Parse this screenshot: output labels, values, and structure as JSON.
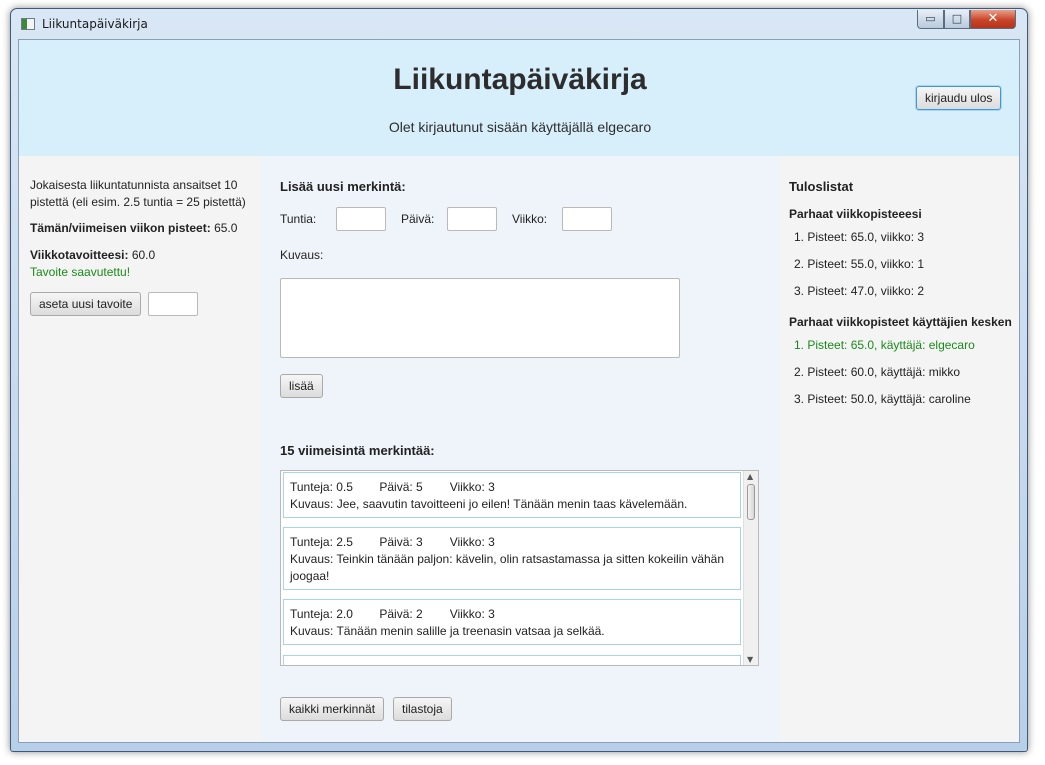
{
  "window": {
    "title": "Liikuntapäiväkirja",
    "controls": {
      "minimize": "▭",
      "maximize": "□",
      "close": "✕"
    }
  },
  "header": {
    "title": "Liikuntapäiväkirja",
    "subtitle": "Olet kirjautunut sisään käyttäjällä elgecaro",
    "logout_label": "kirjaudu ulos"
  },
  "left": {
    "info_line1": "Jokaisesta liikuntatunnista ansaitset 10",
    "info_line2": "pistettä (eli esim. 2.5 tuntia = 25 pistettä)",
    "week_points_label": "Tämän/viimeisen viikon pisteet:",
    "week_points_value": "65.0",
    "goal_label": "Viikkotavoitteesi:",
    "goal_value": "60.0",
    "goal_status": "Tavoite saavutettu!",
    "set_goal_label": "aseta uusi tavoite",
    "goal_input_value": ""
  },
  "form": {
    "heading": "Lisää uusi merkintä:",
    "hours_label": "Tuntia:",
    "day_label": "Päivä:",
    "week_label": "Viikko:",
    "description_label": "Kuvaus:",
    "add_label": "lisää"
  },
  "recent": {
    "heading": "15 viimeisintä merkintää:",
    "entries": [
      {
        "hours": "Tunteja: 0.5",
        "day": "Päivä: 5",
        "week": "Viikko: 3",
        "description": "Kuvaus: Jee, saavutin tavoitteeni jo eilen! Tänään menin taas kävelemään."
      },
      {
        "hours": "Tunteja: 2.5",
        "day": "Päivä: 3",
        "week": "Viikko: 3",
        "description": "Kuvaus: Teinkin tänään paljon: kävelin, olin ratsastamassa ja sitten kokeilin vähän joogaa!"
      },
      {
        "hours": "Tunteja: 2.0",
        "day": "Päivä: 2",
        "week": "Viikko: 3",
        "description": "Kuvaus: Tänään menin salille ja treenasin vatsaa ja selkää."
      }
    ],
    "all_entries_label": "kaikki merkinnät",
    "stats_label": "tilastoja"
  },
  "leaderboards": {
    "title": "Tuloslistat",
    "personal_heading": "Parhaat viikkopisteeesi",
    "personal": [
      "1. Pisteet: 65.0, viikko: 3",
      "2. Pisteet: 55.0, viikko: 1",
      "3. Pisteet: 47.0, viikko: 2"
    ],
    "users_heading": "Parhaat viikkopisteet käyttäjien kesken",
    "users": [
      "1. Pisteet: 65.0, käyttäjä: elgecaro",
      "2. Pisteet: 60.0, käyttäjä: mikko",
      "3. Pisteet: 50.0, käyttäjä: caroline"
    ]
  },
  "colors": {
    "header_bg": "#d7eefb",
    "center_bg": "#eef4fa",
    "success_green": "#1a8a1a",
    "focus_blue": "#3d9bd4"
  }
}
